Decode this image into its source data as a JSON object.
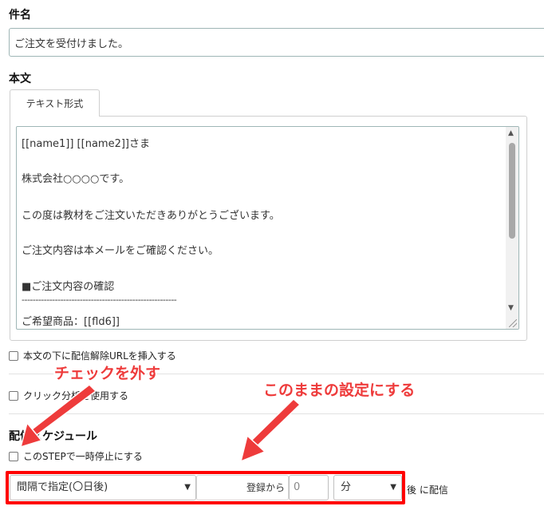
{
  "subject": {
    "label": "件名",
    "value": "ご注文を受付けました。"
  },
  "body": {
    "label": "本文",
    "tab_label": "テキスト形式",
    "lines": [
      "[[name1]] [[name2]]さま",
      "株式会社○○○○です。",
      "この度は教材をご注文いただきありがとうございます。",
      "ご注文内容は本メールをご確認ください。",
      "■ご注文内容の確認",
      "--------------------------------------------------------",
      "ご希望商品：[[fld6]]"
    ]
  },
  "options": {
    "unsubscribe_label": "本文の下に配信解除URLを挿入する",
    "click_analysis_label": "クリック分析を使用する"
  },
  "schedule": {
    "label": "配信スケジュール",
    "pause_label": "このSTEPで一時停止にする",
    "interval_select": "間隔で指定(〇日後)",
    "from_label": "登録から",
    "amount_value": "0",
    "unit_select": "分",
    "suffix_label": "後 に配信"
  },
  "annotations": {
    "uncheck": "チェックを外す",
    "keep": "このままの設定にする",
    "color": "#ee3b3b"
  }
}
